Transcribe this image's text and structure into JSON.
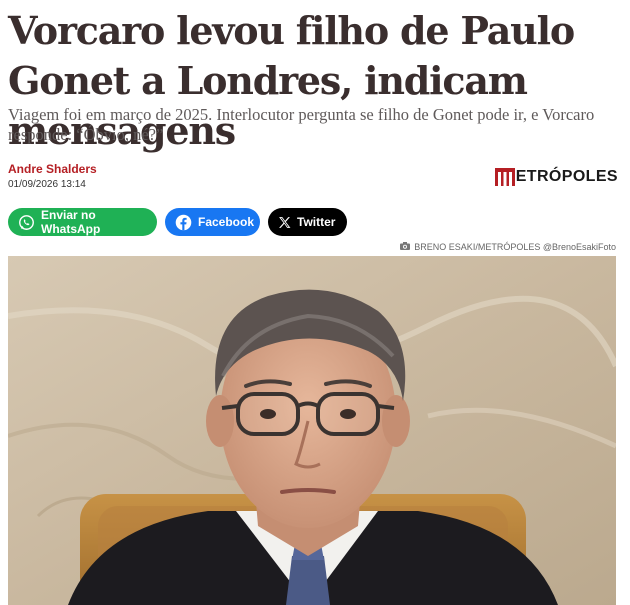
{
  "article": {
    "headline": "Vorcaro levou filho de Paulo Gonet a Londres, indicam mensagens",
    "subtitle": "Viagem foi em março de 2025. Interlocutor pergunta se filho de Gonet pode ir, e Vorcaro responde: “Óbvio, né?”",
    "author": "Andre Shalders",
    "date": "01/09/2026 13:14",
    "photo_credit": "BRENO ESAKI/METRÓPOLES @BrenoEsakiFoto"
  },
  "brand": {
    "logo_text": "ETRÓPOLES",
    "accent_color": "#b51f24"
  },
  "share": {
    "whatsapp_label": "Enviar no WhatsApp",
    "facebook_label": "Facebook",
    "twitter_label": "Twitter",
    "whatsapp_color": "#1fb155",
    "facebook_color": "#1877f2",
    "twitter_color": "#000000"
  },
  "icons": {
    "whatsapp": "whatsapp-icon",
    "facebook": "facebook-icon",
    "twitter": "x-icon",
    "camera": "camera-icon"
  }
}
